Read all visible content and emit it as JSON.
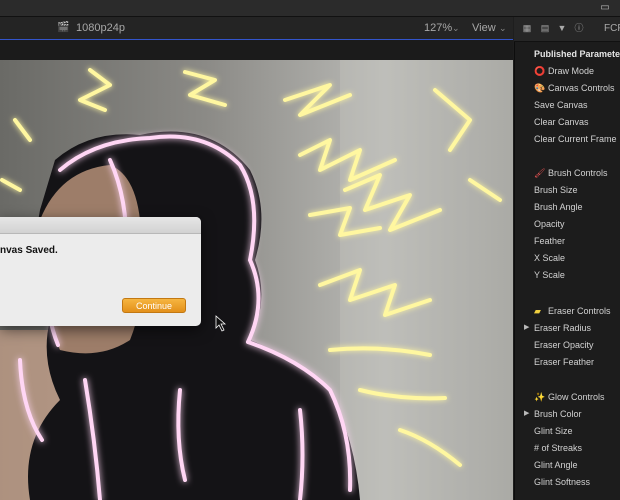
{
  "topbar": {
    "icon": "window-icon"
  },
  "viewer": {
    "format": "1080p24p",
    "zoom": "127%",
    "view_label": "View"
  },
  "inspector": {
    "tab_label": "FCP",
    "header": "Published Parameters",
    "rows": [
      {
        "label": "Draw Mode",
        "icon": "red-circle-icon"
      },
      {
        "label": "Canvas Controls",
        "icon": "palette-icon"
      },
      {
        "label": "Save Canvas"
      },
      {
        "label": "Clear Canvas"
      },
      {
        "label": "Clear Current Frame"
      },
      {
        "label": "Brush Controls",
        "icon": "brush-icon"
      },
      {
        "label": "Brush Size"
      },
      {
        "label": "Brush Angle"
      },
      {
        "label": "Opacity"
      },
      {
        "label": "Feather"
      },
      {
        "label": "X Scale"
      },
      {
        "label": "Y Scale"
      },
      {
        "label": "Eraser Controls",
        "icon": "eraser-icon"
      },
      {
        "label": "Eraser Radius"
      },
      {
        "label": "Eraser Opacity"
      },
      {
        "label": "Eraser Feather"
      },
      {
        "label": "Glow Controls",
        "icon": "sparkles-icon"
      },
      {
        "label": "Brush Color"
      },
      {
        "label": "Glint Size"
      },
      {
        "label": "# of Streaks"
      },
      {
        "label": "Glint Angle"
      },
      {
        "label": "Glint Softness"
      }
    ]
  },
  "dialog": {
    "message": "nvas Saved.",
    "button": "Continue"
  },
  "colors": {
    "accent_blue": "#3355cc",
    "button_orange": "#e8981f",
    "neon_yellow": "#fff7a0",
    "neon_pink": "#ffd6f4"
  }
}
